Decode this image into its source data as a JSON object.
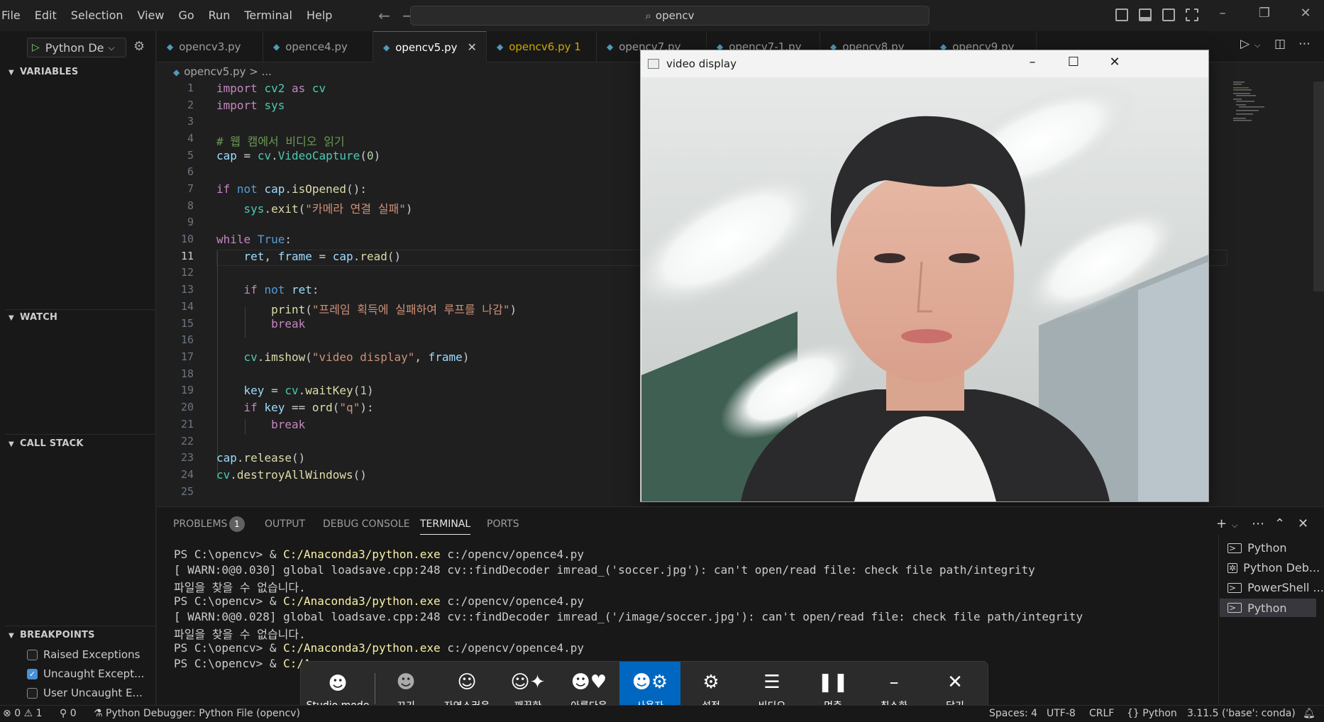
{
  "menu": [
    "File",
    "Edit",
    "Selection",
    "View",
    "Go",
    "Run",
    "Terminal",
    "Help"
  ],
  "search": {
    "text": "opencv",
    "icon": "search-icon"
  },
  "debug": {
    "config": "Python De",
    "sections": {
      "variables": "VARIABLES",
      "watch": "WATCH",
      "call_stack": "CALL STACK",
      "breakpoints": "BREAKPOINTS"
    },
    "breakpoints": [
      {
        "label": "Raised Exceptions",
        "checked": false
      },
      {
        "label": "Uncaught Except...",
        "checked": true
      },
      {
        "label": "User Uncaught E...",
        "checked": false
      }
    ]
  },
  "tabs": [
    {
      "label": "opencv3.py"
    },
    {
      "label": "opence4.py"
    },
    {
      "label": "opencv5.py",
      "active": true
    },
    {
      "label": "opencv6.py 1",
      "warning": true
    },
    {
      "label": "opencv7.py"
    },
    {
      "label": "opencv7-1.py"
    },
    {
      "label": "opencv8.py"
    },
    {
      "label": "opencv9.py"
    }
  ],
  "breadcrumb": {
    "file": "opencv5.py",
    "rest": "> ..."
  },
  "editor": {
    "current_line": 11,
    "line_numbers": [
      "1",
      "2",
      "3",
      "4",
      "5",
      "6",
      "7",
      "8",
      "9",
      "10",
      "11",
      "12",
      "13",
      "14",
      "15",
      "16",
      "17",
      "18",
      "19",
      "20",
      "21",
      "22",
      "23",
      "24",
      "25"
    ],
    "comment_text": "# 웹 캠에서 비디오 읽기",
    "string_fail_camera": "\"카메라 연결 실패\"",
    "string_fail_frame": "\"프레임 획득에 실패하여 루프를 나감\"",
    "string_window": "\"video display\"",
    "string_q": "\"q\""
  },
  "video_window": {
    "title": "video display"
  },
  "panel": {
    "tabs": [
      "PROBLEMS",
      "OUTPUT",
      "DEBUG CONSOLE",
      "TERMINAL",
      "PORTS"
    ],
    "problems_count": "1",
    "active_tab": "TERMINAL",
    "terminal": [
      {
        "prompt": "PS C:\\opencv> & ",
        "exe": "C:/Anaconda3/python.exe",
        "arg": " c:/opencv/opence4.py"
      },
      {
        "text": "[ WARN:0@0.030] global loadsave.cpp:248 cv::findDecoder imread_('soccer.jpg'): can't open/read file: check file path/integrity"
      },
      {
        "text": "파일을 찾을 수 없습니다."
      },
      {
        "prompt": "PS C:\\opencv> & ",
        "exe": "C:/Anaconda3/python.exe",
        "arg": " c:/opencv/opence4.py"
      },
      {
        "text": "[ WARN:0@0.028] global loadsave.cpp:248 cv::findDecoder imread_('/image/soccer.jpg'): can't open/read file: check file path/integrity"
      },
      {
        "text": "파일을 찾을 수 없습니다."
      },
      {
        "prompt": "PS C:\\opencv> & ",
        "exe": "C:/Anaconda3/python.exe",
        "arg": " c:/opencv/opence4.py"
      },
      {
        "prompt": "PS C:\\opencv> & ",
        "exe": "C:/A",
        "arg": ""
      }
    ],
    "terminal_list": [
      "Python",
      "Python Deb...",
      "PowerShell ...",
      "Python"
    ]
  },
  "studio_bar": [
    {
      "label": "Studio mode",
      "icon": "face-icon"
    },
    {
      "label": "끄기",
      "icon": "face-off-icon"
    },
    {
      "label": "자연스러운",
      "icon": "face-natural-icon"
    },
    {
      "label": "깨끗한",
      "icon": "face-clean-icon"
    },
    {
      "label": "아름다운",
      "icon": "face-beauty-icon"
    },
    {
      "label": "사용자",
      "icon": "face-custom-icon",
      "active": true
    },
    {
      "label": "설정",
      "icon": "gear-icon"
    },
    {
      "label": "비디오",
      "icon": "list-icon"
    },
    {
      "label": "멈춤",
      "icon": "pause-icon"
    },
    {
      "label": "최소화",
      "icon": "minimize-icon"
    },
    {
      "label": "닫기",
      "icon": "close-icon"
    }
  ],
  "status": {
    "errors": "0",
    "warnings": "1",
    "ports": "0",
    "debug": "Python Debugger: Python File (opencv)",
    "spaces": "Spaces: 4",
    "encoding": "UTF-8",
    "eol": "CRLF",
    "language": "Python",
    "interpreter": "3.11.5 ('base': conda)"
  },
  "colors": {
    "accent": "#0078d4",
    "studio_active": "#0067c0",
    "keyword": "#c586c0",
    "string": "#ce9178",
    "function": "#dcdcaa"
  }
}
